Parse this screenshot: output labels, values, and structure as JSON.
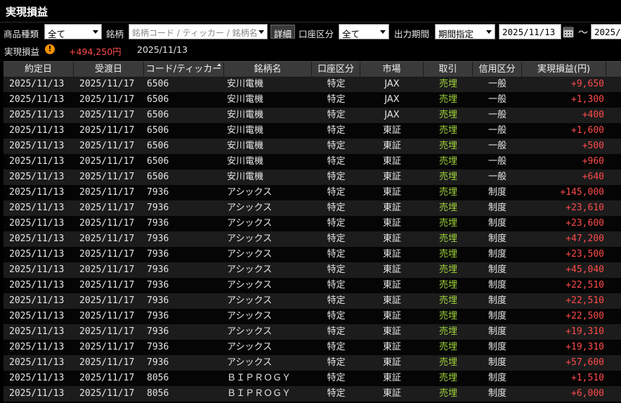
{
  "title": "実現損益",
  "filters": {
    "product_type_label": "商品種類",
    "product_type_value": "全て",
    "symbol_label": "銘柄",
    "symbol_placeholder": "銘柄コード / ティッカー / 銘柄名",
    "detail_button": "詳細",
    "account_label": "口座区分",
    "account_value": "全て",
    "period_label": "出力期間",
    "period_value": "期間指定",
    "date_from": "2025/11/13",
    "tilde": "～",
    "date_to": "2025/11/13"
  },
  "summary": {
    "label": "実現損益",
    "value": "+494,250円",
    "date": "2025/11/13"
  },
  "columns": [
    "約定日",
    "受渡日",
    "コード/ティッカー",
    "銘柄名",
    "口座区分",
    "市場",
    "取引",
    "信用区分",
    "実現損益(円)"
  ],
  "rows": [
    {
      "trade_date": "2025/11/13",
      "settle_date": "2025/11/17",
      "code": "6506",
      "name": "安川電機",
      "account": "特定",
      "market": "JAX",
      "trade": "売埋",
      "credit": "一般",
      "pnl": "+9,650"
    },
    {
      "trade_date": "2025/11/13",
      "settle_date": "2025/11/17",
      "code": "6506",
      "name": "安川電機",
      "account": "特定",
      "market": "JAX",
      "trade": "売埋",
      "credit": "一般",
      "pnl": "+1,300"
    },
    {
      "trade_date": "2025/11/13",
      "settle_date": "2025/11/17",
      "code": "6506",
      "name": "安川電機",
      "account": "特定",
      "market": "JAX",
      "trade": "売埋",
      "credit": "一般",
      "pnl": "+400"
    },
    {
      "trade_date": "2025/11/13",
      "settle_date": "2025/11/17",
      "code": "6506",
      "name": "安川電機",
      "account": "特定",
      "market": "東証",
      "trade": "売埋",
      "credit": "一般",
      "pnl": "+1,600"
    },
    {
      "trade_date": "2025/11/13",
      "settle_date": "2025/11/17",
      "code": "6506",
      "name": "安川電機",
      "account": "特定",
      "market": "東証",
      "trade": "売埋",
      "credit": "一般",
      "pnl": "+500"
    },
    {
      "trade_date": "2025/11/13",
      "settle_date": "2025/11/17",
      "code": "6506",
      "name": "安川電機",
      "account": "特定",
      "market": "東証",
      "trade": "売埋",
      "credit": "一般",
      "pnl": "+960"
    },
    {
      "trade_date": "2025/11/13",
      "settle_date": "2025/11/17",
      "code": "6506",
      "name": "安川電機",
      "account": "特定",
      "market": "東証",
      "trade": "売埋",
      "credit": "一般",
      "pnl": "+640"
    },
    {
      "trade_date": "2025/11/13",
      "settle_date": "2025/11/17",
      "code": "7936",
      "name": "アシックス",
      "account": "特定",
      "market": "東証",
      "trade": "売埋",
      "credit": "制度",
      "pnl": "+145,000"
    },
    {
      "trade_date": "2025/11/13",
      "settle_date": "2025/11/17",
      "code": "7936",
      "name": "アシックス",
      "account": "特定",
      "market": "東証",
      "trade": "売埋",
      "credit": "制度",
      "pnl": "+23,610"
    },
    {
      "trade_date": "2025/11/13",
      "settle_date": "2025/11/17",
      "code": "7936",
      "name": "アシックス",
      "account": "特定",
      "market": "東証",
      "trade": "売埋",
      "credit": "制度",
      "pnl": "+23,600"
    },
    {
      "trade_date": "2025/11/13",
      "settle_date": "2025/11/17",
      "code": "7936",
      "name": "アシックス",
      "account": "特定",
      "market": "東証",
      "trade": "売埋",
      "credit": "制度",
      "pnl": "+47,200"
    },
    {
      "trade_date": "2025/11/13",
      "settle_date": "2025/11/17",
      "code": "7936",
      "name": "アシックス",
      "account": "特定",
      "market": "東証",
      "trade": "売埋",
      "credit": "制度",
      "pnl": "+23,500"
    },
    {
      "trade_date": "2025/11/13",
      "settle_date": "2025/11/17",
      "code": "7936",
      "name": "アシックス",
      "account": "特定",
      "market": "東証",
      "trade": "売埋",
      "credit": "制度",
      "pnl": "+45,040"
    },
    {
      "trade_date": "2025/11/13",
      "settle_date": "2025/11/17",
      "code": "7936",
      "name": "アシックス",
      "account": "特定",
      "market": "東証",
      "trade": "売埋",
      "credit": "制度",
      "pnl": "+22,510"
    },
    {
      "trade_date": "2025/11/13",
      "settle_date": "2025/11/17",
      "code": "7936",
      "name": "アシックス",
      "account": "特定",
      "market": "東証",
      "trade": "売埋",
      "credit": "制度",
      "pnl": "+22,510"
    },
    {
      "trade_date": "2025/11/13",
      "settle_date": "2025/11/17",
      "code": "7936",
      "name": "アシックス",
      "account": "特定",
      "market": "東証",
      "trade": "売埋",
      "credit": "制度",
      "pnl": "+22,500"
    },
    {
      "trade_date": "2025/11/13",
      "settle_date": "2025/11/17",
      "code": "7936",
      "name": "アシックス",
      "account": "特定",
      "market": "東証",
      "trade": "売埋",
      "credit": "制度",
      "pnl": "+19,310"
    },
    {
      "trade_date": "2025/11/13",
      "settle_date": "2025/11/17",
      "code": "7936",
      "name": "アシックス",
      "account": "特定",
      "market": "東証",
      "trade": "売埋",
      "credit": "制度",
      "pnl": "+19,310"
    },
    {
      "trade_date": "2025/11/13",
      "settle_date": "2025/11/17",
      "code": "7936",
      "name": "アシックス",
      "account": "特定",
      "market": "東証",
      "trade": "売埋",
      "credit": "制度",
      "pnl": "+57,600"
    },
    {
      "trade_date": "2025/11/13",
      "settle_date": "2025/11/17",
      "code": "8056",
      "name": "ＢＩＰＲＯＧＹ",
      "account": "特定",
      "market": "東証",
      "trade": "売埋",
      "credit": "制度",
      "pnl": "+1,510"
    },
    {
      "trade_date": "2025/11/13",
      "settle_date": "2025/11/17",
      "code": "8056",
      "name": "ＢＩＰＲＯＧＹ",
      "account": "特定",
      "market": "東証",
      "trade": "売埋",
      "credit": "制度",
      "pnl": "+6,000"
    }
  ],
  "colors": {
    "background": "#000000",
    "header_bg": "#3a3a3a",
    "row_odd": "#1c1c1c",
    "row_even": "#050505",
    "profit": "#ff4a4a",
    "trade_green": "#9fd33a",
    "warning": "#f29100"
  },
  "icons": {
    "warning": "exclamation-circle-icon",
    "calendar": "calendar-icon",
    "sort": "sort-ascending-icon"
  }
}
